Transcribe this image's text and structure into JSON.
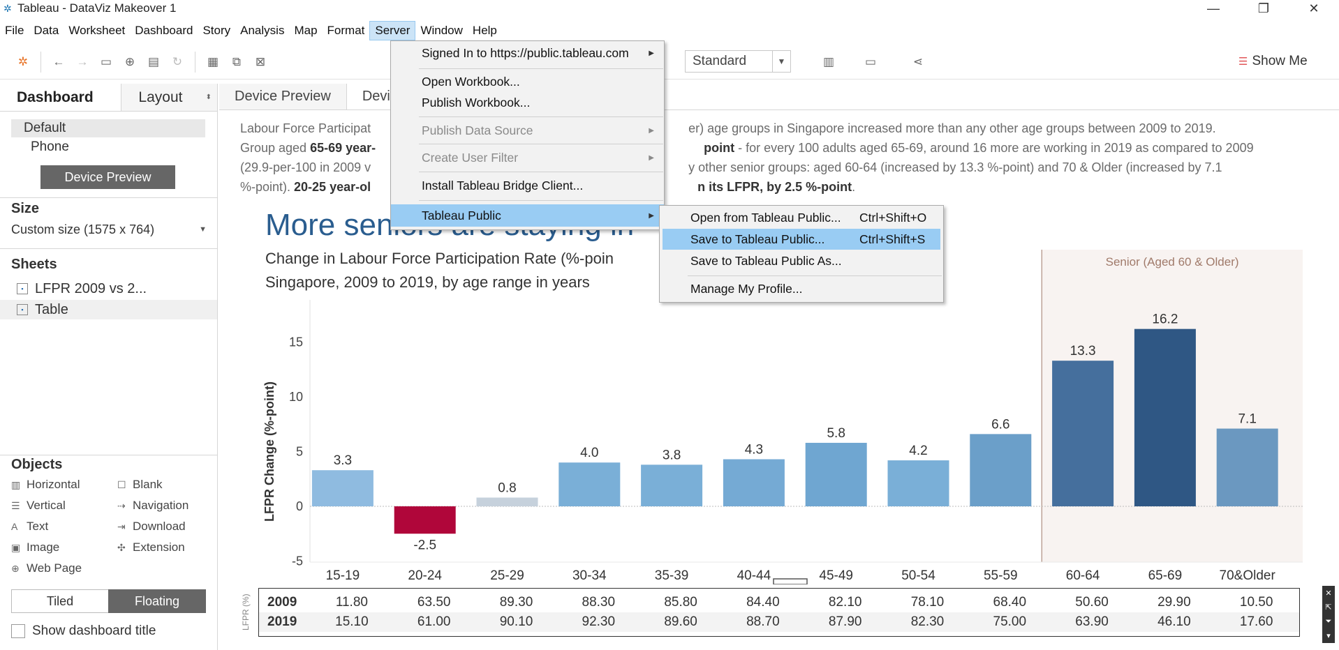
{
  "window": {
    "title": "Tableau - DataViz Makeover 1"
  },
  "menubar": [
    "File",
    "Data",
    "Worksheet",
    "Dashboard",
    "Story",
    "Analysis",
    "Map",
    "Format",
    "Server",
    "Window",
    "Help"
  ],
  "toolbar": {
    "fit_value": "Standard",
    "show_me": "Show Me"
  },
  "left_panel": {
    "tabs": {
      "dashboard": "Dashboard",
      "layout": "Layout"
    },
    "devices": [
      "Default",
      "Phone"
    ],
    "device_preview_button": "Device Preview",
    "size_title": "Size",
    "size_value": "Custom size (1575 x 764)",
    "sheets_title": "Sheets",
    "sheets": [
      "LFPR 2009 vs 2...",
      "Table"
    ],
    "objects_title": "Objects",
    "objects": [
      {
        "label": "Horizontal",
        "icon": "horizontal-icon"
      },
      {
        "label": "Blank",
        "icon": "blank-icon"
      },
      {
        "label": "Vertical",
        "icon": "vertical-icon"
      },
      {
        "label": "Navigation",
        "icon": "navigation-icon"
      },
      {
        "label": "Text",
        "icon": "text-icon"
      },
      {
        "label": "Download",
        "icon": "download-icon"
      },
      {
        "label": "Image",
        "icon": "image-icon"
      },
      {
        "label": "Extension",
        "icon": "extension-icon"
      },
      {
        "label": "Web Page",
        "icon": "web-page-icon"
      }
    ],
    "tiled": "Tiled",
    "floating": "Floating",
    "show_title": "Show dashboard title"
  },
  "canvas_tabs": [
    "Device Preview",
    "Devi"
  ],
  "description": {
    "line1_a": "Labour Force Participat",
    "line1_b": "er) age groups in Singapore increased more than any other age groups between 2009 to 2019.",
    "line2_a": "Group aged ",
    "line2_bold": "65-69 year-",
    "line2_b": "point",
    "line2_c": "  - for every 100 adults aged 65-69, around 16 more are working in 2019 as compared to 2009",
    "line3_a": "(29.9-per-100 in 2009 v",
    "line3_b": "y other senior groups: aged 60-64 (increased by 13.3 %-point) and 70 & Older (increased by 7.1",
    "line4_a": "%-point). ",
    "line4_bold": "20-25 year-ol",
    "line4_bold2": "n its LFPR, by 2.5 %-point",
    "line4_end": "."
  },
  "dashboard": {
    "title": "More seniors are staying in",
    "subtitle_line1": "Change in Labour Force Participation Rate (%-poin",
    "subtitle_line2": "Singapore, 2009 to 2019, by age range in years",
    "senior_band_label": "Senior (Aged 60 & Older)"
  },
  "chart_data": {
    "type": "bar",
    "categories": [
      "15-19",
      "20-24",
      "25-29",
      "30-34",
      "35-39",
      "40-44",
      "45-49",
      "50-54",
      "55-59",
      "60-64",
      "65-69",
      "70&Older"
    ],
    "values": [
      3.3,
      -2.5,
      0.8,
      4.0,
      3.8,
      4.3,
      5.8,
      4.2,
      6.6,
      13.3,
      16.2,
      7.1
    ],
    "value_labels": [
      "3.3",
      "-2.5",
      "0.8",
      "4.0",
      "3.8",
      "4.3",
      "5.8",
      "4.2",
      "6.6",
      "13.3",
      "16.2",
      "7.1"
    ],
    "ylabel": "LFPR Change (%-point)",
    "yticks": [
      "15",
      "10",
      "5",
      "0",
      "-5"
    ],
    "ylim": [
      -5.5,
      17
    ],
    "colors": [
      "#8fbbe0",
      "#b0063a",
      "#c6d1dc",
      "#7aafd7",
      "#7aafd7",
      "#75aad4",
      "#6fa6d1",
      "#7aafd7",
      "#6b9fc9",
      "#456f9d",
      "#2f5784",
      "#6b98c0"
    ],
    "table": {
      "ylabel": "LFPR (%)",
      "rows": [
        {
          "year": "2009",
          "values": [
            "11.80",
            "63.50",
            "89.30",
            "88.30",
            "85.80",
            "84.40",
            "82.10",
            "78.10",
            "68.40",
            "50.60",
            "29.90",
            "10.50"
          ]
        },
        {
          "year": "2019",
          "values": [
            "15.10",
            "61.00",
            "90.10",
            "92.30",
            "89.60",
            "88.70",
            "87.90",
            "82.30",
            "75.00",
            "63.90",
            "46.10",
            "17.60"
          ]
        }
      ]
    }
  },
  "server_menu": {
    "signed_in": "Signed In to https://public.tableau.com",
    "open_workbook": "Open Workbook...",
    "publish_workbook": "Publish Workbook...",
    "publish_data_source": "Publish Data Source",
    "create_user_filter": "Create User Filter",
    "install_bridge": "Install Tableau Bridge Client...",
    "tableau_public": "Tableau Public"
  },
  "public_submenu": [
    {
      "label": "Open from Tableau Public...",
      "shortcut": "Ctrl+Shift+O"
    },
    {
      "label": "Save to Tableau Public...",
      "shortcut": "Ctrl+Shift+S"
    },
    {
      "label": "Save to Tableau Public As...",
      "shortcut": ""
    },
    {
      "label": "Manage My Profile...",
      "shortcut": ""
    }
  ]
}
